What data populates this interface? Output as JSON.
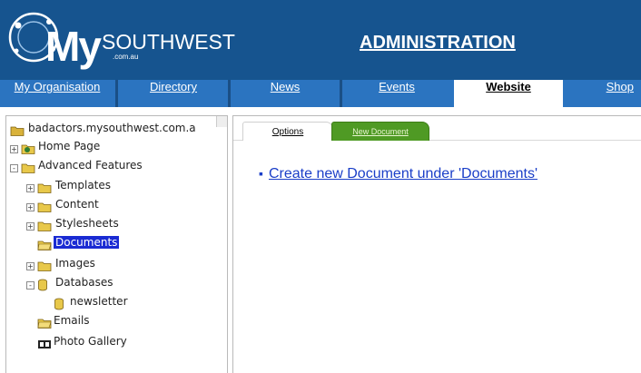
{
  "header": {
    "logo": {
      "my": "My",
      "southwest": "SOUTHWEST",
      "domain": ".com.au"
    },
    "title": "ADMINISTRATION"
  },
  "nav": {
    "items": [
      {
        "label": "My Organisation"
      },
      {
        "label": "Directory"
      },
      {
        "label": "News"
      },
      {
        "label": "Events"
      },
      {
        "label": "Website",
        "active": true
      },
      {
        "label": "Shop"
      }
    ]
  },
  "tree": {
    "root": "badactors.mysouthwest.com.a",
    "items": [
      {
        "label": "Home Page",
        "expander": "+"
      },
      {
        "label": "Advanced Features",
        "expander": "-"
      },
      {
        "label": "Templates",
        "expander": "+"
      },
      {
        "label": "Content",
        "expander": "+"
      },
      {
        "label": "Stylesheets",
        "expander": "+"
      },
      {
        "label": "Documents",
        "selected": true
      },
      {
        "label": "Images",
        "expander": "+"
      },
      {
        "label": "Databases",
        "expander": "-"
      },
      {
        "label": "newsletter"
      },
      {
        "label": "Emails"
      },
      {
        "label": "Photo Gallery"
      }
    ]
  },
  "tabs": {
    "options": "Options",
    "new_document": "New Document"
  },
  "content": {
    "create_link": "Create new Document under 'Documents'"
  },
  "colors": {
    "header_bg": "#16548f",
    "nav_bg": "#2b74c0",
    "tab_green": "#4f9a24",
    "link_blue": "#1a3ec8",
    "selection": "#1a2bd3",
    "folder_yellow": "#e8c84a"
  }
}
